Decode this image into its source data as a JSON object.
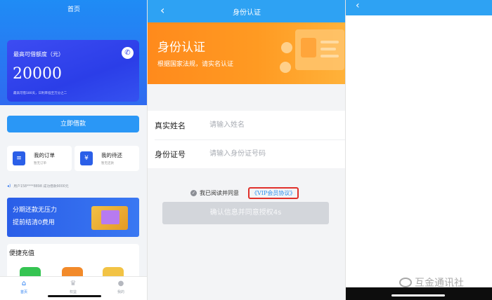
{
  "home": {
    "title": "首页",
    "card": {
      "label": "最高可借额度（元）",
      "amount": "20000",
      "note": "最高可借180天，日利率低至万分之二"
    },
    "borrow_button": "立即借款",
    "tiles": [
      {
        "title": "我的订单",
        "subtitle": "暂无订单",
        "icon": "document-icon"
      },
      {
        "title": "我的待还",
        "subtitle": "暂无还款",
        "icon": "yen-icon"
      }
    ],
    "ticker": "用户158****8898 成功借款9000元",
    "banner": {
      "line1": "分期还款无压力",
      "line2": "提前结清0费用"
    },
    "quick_title": "便捷充值",
    "tabs": [
      {
        "label": "首页",
        "icon": "home-icon",
        "active": true
      },
      {
        "label": "权益",
        "icon": "crown-icon",
        "active": false
      },
      {
        "label": "我的",
        "icon": "person-icon",
        "active": false
      }
    ]
  },
  "identity": {
    "nav_title": "身份认证",
    "hero_title": "身份认证",
    "hero_subtitle": "根据国家法规，请实名认证",
    "fields": [
      {
        "label": "真实姓名",
        "placeholder": "请输入姓名"
      },
      {
        "label": "身份证号",
        "placeholder": "请输入身份证号码"
      }
    ],
    "agree_text": "我已阅读并同意",
    "agreement_link": "《VIP会员协议》",
    "confirm_button": "确认信息并同意授权4s"
  },
  "watermark": "互金通讯社",
  "colors": {
    "primary_blue": "#2ea2f3",
    "card_blue": "#2b3ee8",
    "hero_orange": "#ff8a1c",
    "link_blue": "#2c8ff0",
    "highlight_red": "#e0302a"
  }
}
